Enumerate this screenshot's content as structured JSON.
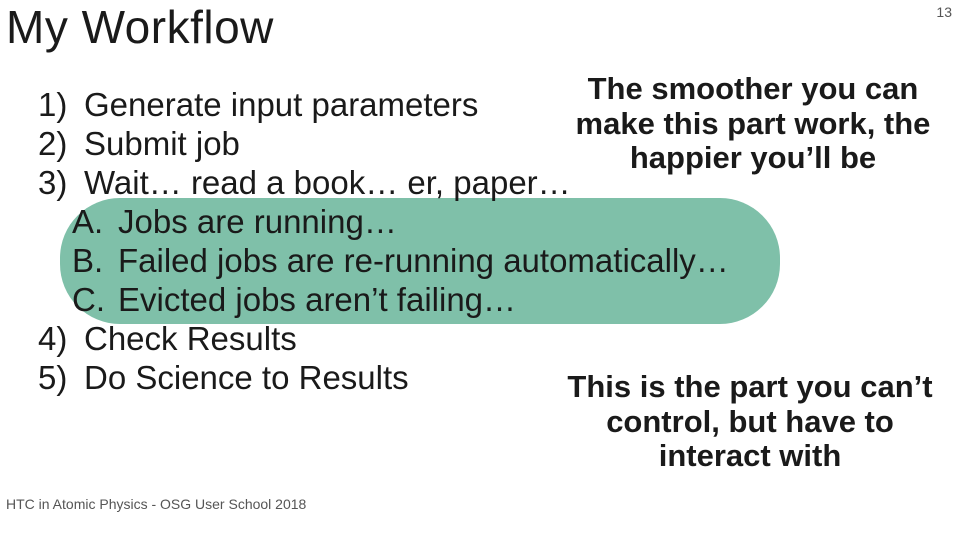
{
  "page_number": "13",
  "title": "My Workflow",
  "footer": "HTC in Atomic Physics - OSG User School 2018",
  "list": {
    "n1": "1)",
    "t1": "Generate input parameters",
    "n2": "2)",
    "t2": "Submit job",
    "n3": "3)",
    "t3": "Wait… read a book… er, paper…",
    "nA": "A.",
    "tA": "Jobs are running…",
    "nB": "B.",
    "tB": "Failed jobs are re-running automatically…",
    "nC": "C.",
    "tC": "Evicted jobs aren’t failing…",
    "n4": "4)",
    "t4": "Check Results",
    "n5": "5)",
    "t5": "Do Science to Results"
  },
  "callout1": "The smoother you can make this part work, the happier you’ll be",
  "callout2": "This is the part you can’t control, but have to interact with"
}
